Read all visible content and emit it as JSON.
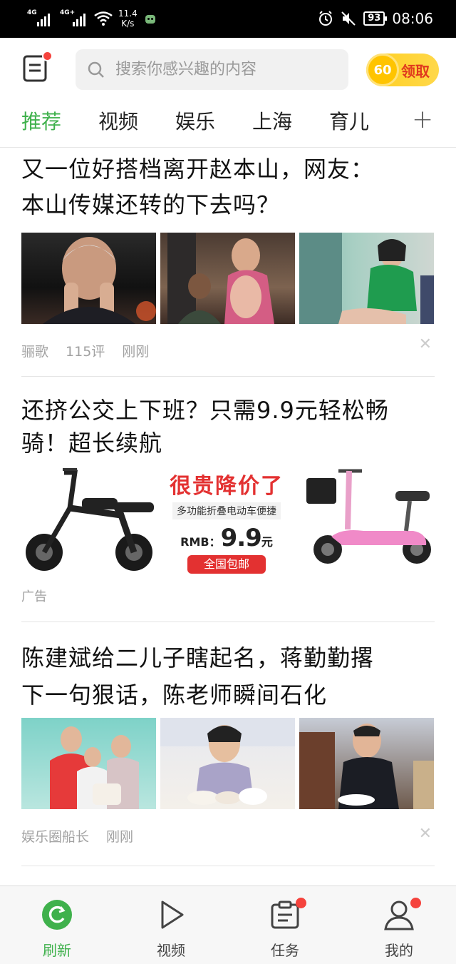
{
  "status_bar": {
    "network1": "4G",
    "network2": "4G+",
    "speed_value": "11.4",
    "speed_unit": "K/s",
    "battery": "93",
    "time": "08:06"
  },
  "header": {
    "search_placeholder": "搜索你感兴趣的内容",
    "coin_amount": "60",
    "coin_label": "领取"
  },
  "tabs": [
    {
      "label": "推荐",
      "active": true
    },
    {
      "label": "视频",
      "active": false
    },
    {
      "label": "娱乐",
      "active": false
    },
    {
      "label": "上海",
      "active": false
    },
    {
      "label": "育儿",
      "active": false
    }
  ],
  "tab_add": "+",
  "articles": [
    {
      "title_line1": "又一位好搭档离开赵本山，网友：",
      "title_line2": "本山传媒还转的下去吗？",
      "source": "骊歌",
      "comments": "115评",
      "time": "刚刚"
    },
    {
      "title_line1": "还挤公交上下班？只需9.9元轻松畅",
      "title_line2": "骑！超长续航",
      "ad_headline": "很贵降价了",
      "ad_subtitle": "多功能折叠电动车便捷",
      "ad_currency": "RMB：",
      "ad_price": "9.9",
      "ad_unit": "元",
      "ad_shipping": "全国包邮",
      "ad_tag": "广告"
    },
    {
      "title_line1": "陈建斌给二儿子瞎起名，蒋勤勤撂",
      "title_line2": "下一句狠话，陈老师瞬间石化",
      "source": "娱乐圈船长",
      "time": "刚刚"
    }
  ],
  "bottom_nav": [
    {
      "label": "刷新",
      "icon": "refresh-icon",
      "active": true
    },
    {
      "label": "视频",
      "icon": "play-icon",
      "active": false
    },
    {
      "label": "任务",
      "icon": "task-icon",
      "active": false,
      "badge": true
    },
    {
      "label": "我的",
      "icon": "user-icon",
      "active": false,
      "badge": true
    }
  ],
  "colors": {
    "accent": "#3fb14c",
    "badge": "#f5433d",
    "coin": "#ffc400"
  }
}
